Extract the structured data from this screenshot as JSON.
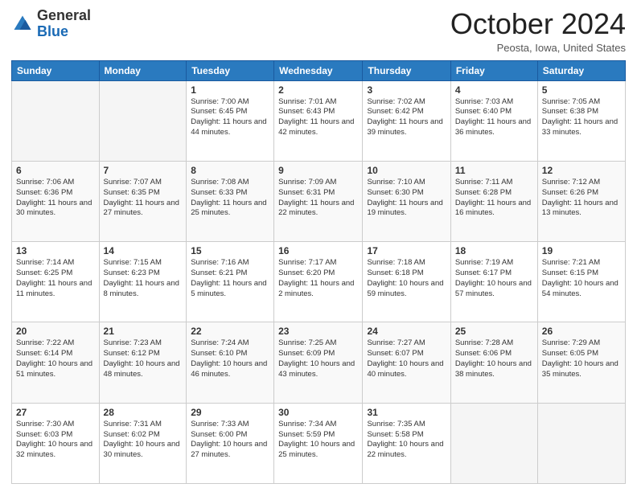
{
  "header": {
    "logo_general": "General",
    "logo_blue": "Blue",
    "month_title": "October 2024",
    "location": "Peosta, Iowa, United States"
  },
  "days_of_week": [
    "Sunday",
    "Monday",
    "Tuesday",
    "Wednesday",
    "Thursday",
    "Friday",
    "Saturday"
  ],
  "weeks": [
    [
      {
        "day": "",
        "info": ""
      },
      {
        "day": "",
        "info": ""
      },
      {
        "day": "1",
        "info": "Sunrise: 7:00 AM\nSunset: 6:45 PM\nDaylight: 11 hours and 44 minutes."
      },
      {
        "day": "2",
        "info": "Sunrise: 7:01 AM\nSunset: 6:43 PM\nDaylight: 11 hours and 42 minutes."
      },
      {
        "day": "3",
        "info": "Sunrise: 7:02 AM\nSunset: 6:42 PM\nDaylight: 11 hours and 39 minutes."
      },
      {
        "day": "4",
        "info": "Sunrise: 7:03 AM\nSunset: 6:40 PM\nDaylight: 11 hours and 36 minutes."
      },
      {
        "day": "5",
        "info": "Sunrise: 7:05 AM\nSunset: 6:38 PM\nDaylight: 11 hours and 33 minutes."
      }
    ],
    [
      {
        "day": "6",
        "info": "Sunrise: 7:06 AM\nSunset: 6:36 PM\nDaylight: 11 hours and 30 minutes."
      },
      {
        "day": "7",
        "info": "Sunrise: 7:07 AM\nSunset: 6:35 PM\nDaylight: 11 hours and 27 minutes."
      },
      {
        "day": "8",
        "info": "Sunrise: 7:08 AM\nSunset: 6:33 PM\nDaylight: 11 hours and 25 minutes."
      },
      {
        "day": "9",
        "info": "Sunrise: 7:09 AM\nSunset: 6:31 PM\nDaylight: 11 hours and 22 minutes."
      },
      {
        "day": "10",
        "info": "Sunrise: 7:10 AM\nSunset: 6:30 PM\nDaylight: 11 hours and 19 minutes."
      },
      {
        "day": "11",
        "info": "Sunrise: 7:11 AM\nSunset: 6:28 PM\nDaylight: 11 hours and 16 minutes."
      },
      {
        "day": "12",
        "info": "Sunrise: 7:12 AM\nSunset: 6:26 PM\nDaylight: 11 hours and 13 minutes."
      }
    ],
    [
      {
        "day": "13",
        "info": "Sunrise: 7:14 AM\nSunset: 6:25 PM\nDaylight: 11 hours and 11 minutes."
      },
      {
        "day": "14",
        "info": "Sunrise: 7:15 AM\nSunset: 6:23 PM\nDaylight: 11 hours and 8 minutes."
      },
      {
        "day": "15",
        "info": "Sunrise: 7:16 AM\nSunset: 6:21 PM\nDaylight: 11 hours and 5 minutes."
      },
      {
        "day": "16",
        "info": "Sunrise: 7:17 AM\nSunset: 6:20 PM\nDaylight: 11 hours and 2 minutes."
      },
      {
        "day": "17",
        "info": "Sunrise: 7:18 AM\nSunset: 6:18 PM\nDaylight: 10 hours and 59 minutes."
      },
      {
        "day": "18",
        "info": "Sunrise: 7:19 AM\nSunset: 6:17 PM\nDaylight: 10 hours and 57 minutes."
      },
      {
        "day": "19",
        "info": "Sunrise: 7:21 AM\nSunset: 6:15 PM\nDaylight: 10 hours and 54 minutes."
      }
    ],
    [
      {
        "day": "20",
        "info": "Sunrise: 7:22 AM\nSunset: 6:14 PM\nDaylight: 10 hours and 51 minutes."
      },
      {
        "day": "21",
        "info": "Sunrise: 7:23 AM\nSunset: 6:12 PM\nDaylight: 10 hours and 48 minutes."
      },
      {
        "day": "22",
        "info": "Sunrise: 7:24 AM\nSunset: 6:10 PM\nDaylight: 10 hours and 46 minutes."
      },
      {
        "day": "23",
        "info": "Sunrise: 7:25 AM\nSunset: 6:09 PM\nDaylight: 10 hours and 43 minutes."
      },
      {
        "day": "24",
        "info": "Sunrise: 7:27 AM\nSunset: 6:07 PM\nDaylight: 10 hours and 40 minutes."
      },
      {
        "day": "25",
        "info": "Sunrise: 7:28 AM\nSunset: 6:06 PM\nDaylight: 10 hours and 38 minutes."
      },
      {
        "day": "26",
        "info": "Sunrise: 7:29 AM\nSunset: 6:05 PM\nDaylight: 10 hours and 35 minutes."
      }
    ],
    [
      {
        "day": "27",
        "info": "Sunrise: 7:30 AM\nSunset: 6:03 PM\nDaylight: 10 hours and 32 minutes."
      },
      {
        "day": "28",
        "info": "Sunrise: 7:31 AM\nSunset: 6:02 PM\nDaylight: 10 hours and 30 minutes."
      },
      {
        "day": "29",
        "info": "Sunrise: 7:33 AM\nSunset: 6:00 PM\nDaylight: 10 hours and 27 minutes."
      },
      {
        "day": "30",
        "info": "Sunrise: 7:34 AM\nSunset: 5:59 PM\nDaylight: 10 hours and 25 minutes."
      },
      {
        "day": "31",
        "info": "Sunrise: 7:35 AM\nSunset: 5:58 PM\nDaylight: 10 hours and 22 minutes."
      },
      {
        "day": "",
        "info": ""
      },
      {
        "day": "",
        "info": ""
      }
    ]
  ]
}
